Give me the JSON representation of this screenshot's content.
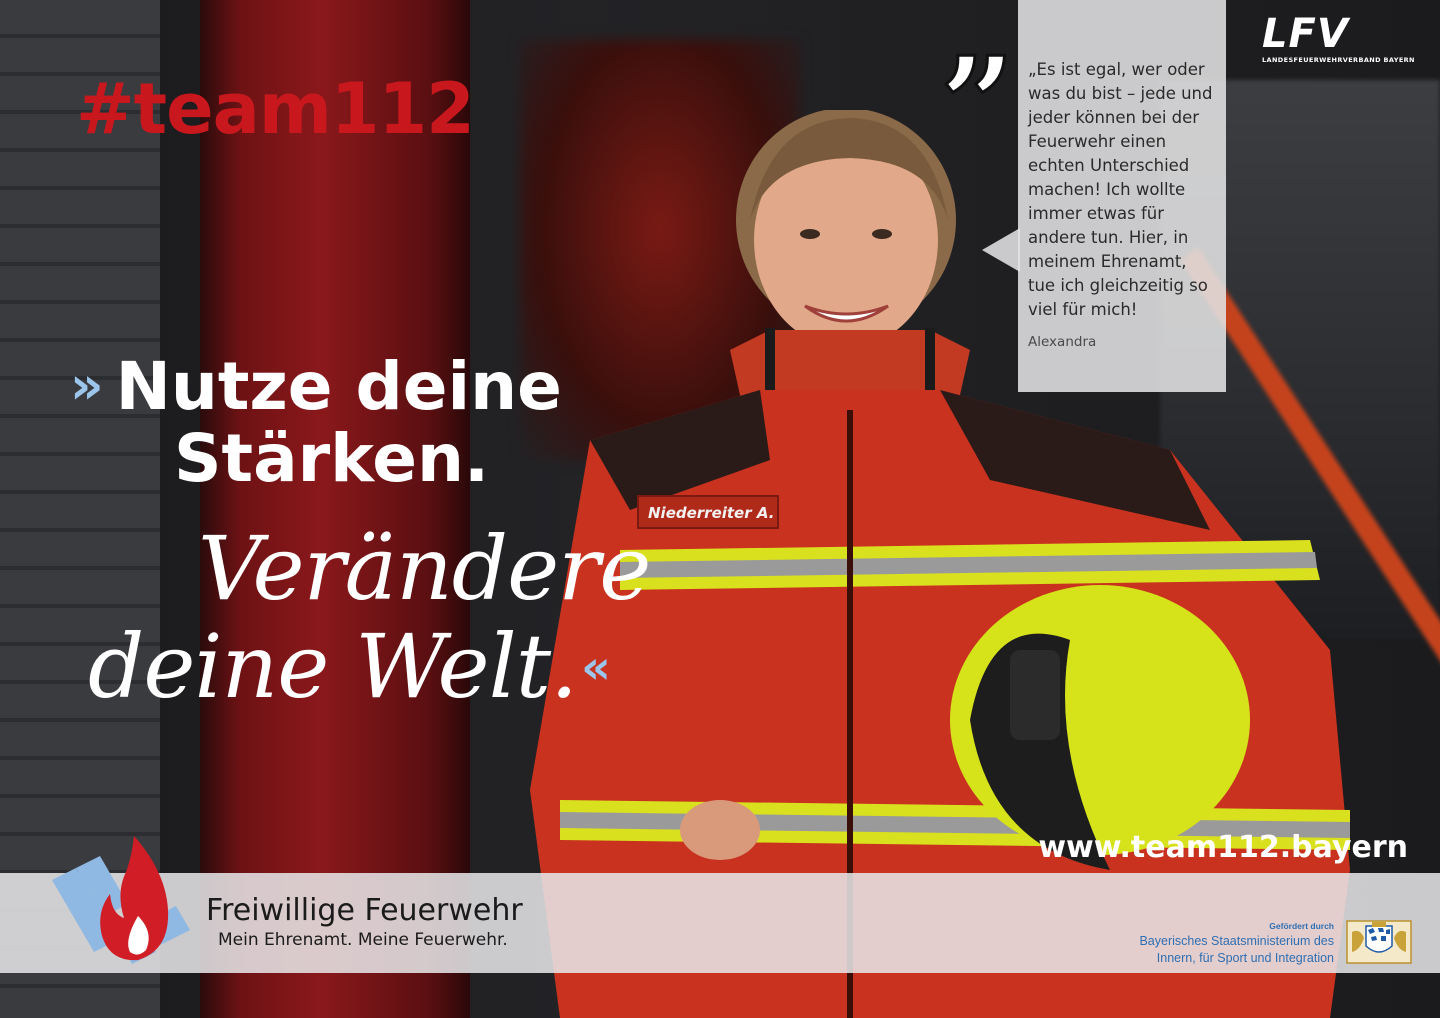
{
  "hashtag": "#team112",
  "headline": {
    "open_quote": "»",
    "line1": "Nutze deine",
    "line2": "Stärken.",
    "script_line1": "Verändere",
    "script_line2": "deine Welt.",
    "close_quote": "«"
  },
  "quote": {
    "text": "„Es ist egal, wer oder was du bist – jede und jeder können bei der Feuerwehr einen echten Unterschied machen! Ich wollte immer etwas für andere tun. Hier, in meinem Ehrenamt, tue ich gleichzeitig so viel für mich!",
    "author": "Alexandra"
  },
  "lfv_logo": {
    "mark": "LFV",
    "subtitle": "LANDESFEUERWEHRVERBAND BAYERN"
  },
  "jacket_name_tag": "Niederreiter A.",
  "url": "www.team112.bayern",
  "banner": {
    "title": "Freiwillige Feuerwehr",
    "subtitle": "Mein Ehrenamt. Meine Feuerwehr.",
    "sponsor_label": "Gefördert durch",
    "sponsor_line1": "Bayerisches Staatsministerium des",
    "sponsor_line2": "Innern, für Sport und Integration"
  },
  "colors": {
    "hashtag_red": "#c8181e",
    "quote_blue": "#9cc5ec",
    "sponsor_blue": "#2f6fb3",
    "jacket_red": "#c8321f",
    "reflective_yellow": "#d9e01e"
  }
}
